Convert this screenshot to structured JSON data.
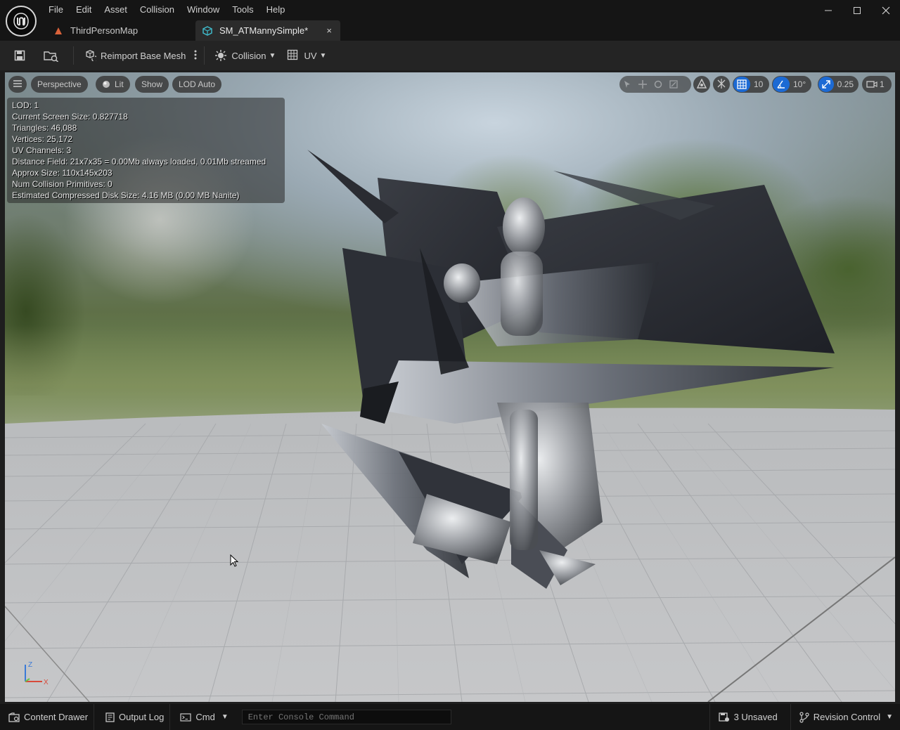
{
  "menu": [
    "File",
    "Edit",
    "Asset",
    "Collision",
    "Window",
    "Tools",
    "Help"
  ],
  "tabs": [
    {
      "label": "ThirdPersonMap",
      "icon": "map-icon"
    },
    {
      "label": "SM_ATMannySimple*",
      "icon": "static-mesh-icon",
      "close": "×"
    }
  ],
  "window_controls": {
    "minimize": "—",
    "maximize": "☐",
    "close": "✕"
  },
  "toolbar": {
    "reimport_label": "Reimport Base Mesh",
    "collision_label": "Collision",
    "uv_label": "UV"
  },
  "viewport_toolbar": {
    "perspective": "Perspective",
    "lit": "Lit",
    "show": "Show",
    "lod": "LOD Auto",
    "grid_snap": "10",
    "rotation_snap": "10°",
    "scale_snap": "0.25",
    "camera_speed": "1"
  },
  "stats": [
    "LOD:  1",
    "Current Screen Size:  0.827718",
    "Triangles:  46,088",
    "Vertices:  25,172",
    "UV Channels:  3",
    "Distance Field:  21x7x35 = 0.00Mb always loaded, 0.01Mb streamed",
    "Approx Size: 110x145x203",
    "Num Collision Primitives:  0",
    "Estimated Compressed Disk Size: 4.16 MB (0.00 MB Nanite)"
  ],
  "axis": {
    "z": "Z",
    "x": "X"
  },
  "statusbar": {
    "content_drawer": "Content Drawer",
    "output_log": "Output Log",
    "cmd": "Cmd",
    "console_placeholder": "Enter Console Command",
    "unsaved": "3 Unsaved",
    "revision_control": "Revision Control"
  },
  "colors": {
    "accent_blue": "#1c6ad4",
    "background": "#151515",
    "toolbar": "#242424"
  }
}
